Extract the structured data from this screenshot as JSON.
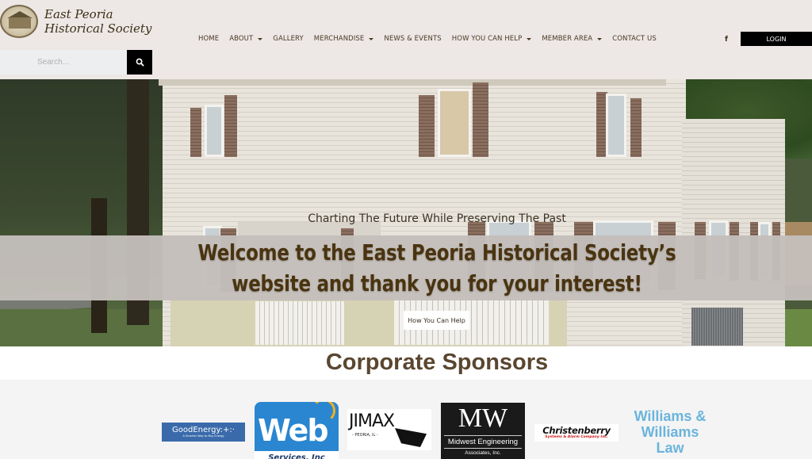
{
  "header": {
    "logo_line1": "East Peoria",
    "logo_line2": "Historical Society",
    "search_placeholder": "Search...",
    "nav": [
      {
        "label": "HOME",
        "dropdown": false
      },
      {
        "label": "ABOUT",
        "dropdown": true
      },
      {
        "label": "GALLERY",
        "dropdown": false
      },
      {
        "label": "MERCHANDISE",
        "dropdown": true
      },
      {
        "label": "NEWS & EVENTS",
        "dropdown": false
      },
      {
        "label": "HOW YOU CAN HELP",
        "dropdown": true
      },
      {
        "label": "MEMBER AREA",
        "dropdown": true
      },
      {
        "label": "CONTACT US",
        "dropdown": false
      }
    ],
    "facebook_glyph": "f",
    "login_label": "LOGIN"
  },
  "hero": {
    "tagline": "Charting The Future While Preserving The Past",
    "welcome_line1": "Welcome to the East Peoria Historical Society’s",
    "welcome_line2": "website and thank you for your interest!",
    "cta_label": "How You Can Help"
  },
  "sponsors": {
    "title": "Corporate Sponsors",
    "items": [
      {
        "name": "GoodEnergy",
        "label": "GoodEnergy:+:·",
        "tagline": "A Smarter Way to Buy Energy"
      },
      {
        "name": "Web Services, Inc",
        "label": "Web",
        "subtitle": "Services, Inc"
      },
      {
        "name": "JIMAX",
        "label": "JIMAX",
        "subtitle": "- PEORIA, IL -"
      },
      {
        "name": "Midwest Engineering Associates, Inc.",
        "label": "MW",
        "line2": "Midwest Engineering",
        "line3": "Associates, Inc."
      },
      {
        "name": "Christenberry",
        "label": "Christenberry",
        "subtitle": "Systems & Alarm Company Inc."
      },
      {
        "name": "Williams & Williams Law",
        "line1": "Williams &",
        "line2": "Williams",
        "line3": "Law"
      }
    ]
  },
  "colors": {
    "header_bg": "#ede7e6",
    "nav_text": "#4a3a22",
    "welcome_text": "#4a3410",
    "banner_bg": "#c4beba",
    "sponsor_title": "#5a4630",
    "williams_blue": "#6ab4dc"
  }
}
